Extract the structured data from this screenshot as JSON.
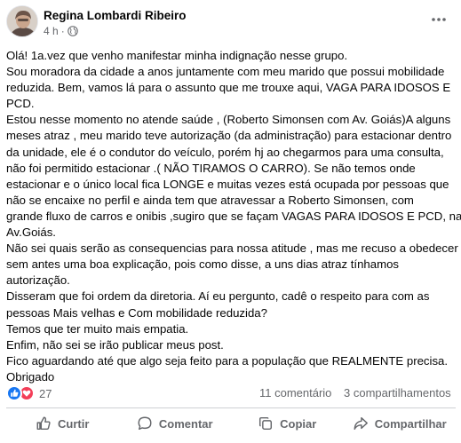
{
  "post": {
    "author": "Regina Lombardi Ribeiro",
    "time": "4 h",
    "meta_separator": "·",
    "privacy_icon": "globe-icon",
    "more_icon": "more-horizontal-icon",
    "text_lines": [
      "Olá! 1a.vez que venho manifestar minha indignação nesse grupo.",
      "Sou moradora da cidade a anos juntamente com meu marido que possui mobilidade",
      "reduzida. Bem, vamos lá para o assunto que me trouxe aqui, VAGA PARA IDOSOS E",
      "PCD.",
      "Estou nesse momento no atende saúde , (Roberto Simonsen com Av. Goiás)A alguns",
      "meses atraz , meu marido teve autorização (da administração) para estacionar dentro",
      "da unidade, ele é o condutor do veículo, porém hj ao chegarmos para uma consulta,",
      "não foi permitido estacionar .( NÃO TIRAMOS O CARRO). Se não temos onde",
      "estacionar e o único local fica LONGE e  muitas vezes está ocupada  por pessoas que",
      "não  se encaixe no perfil e ainda tem que atravessar a Roberto Simonsen,  com",
      "grande fluxo de carros e onibis ,sugiro que se façam VAGAS PARA IDOSOS E PCD, na",
      "Av.Goiás.",
      "Não sei quais serão as consequencias para nossa atitude , mas me recuso a obedecer",
      "sem antes uma boa explicação,  pois como disse, a uns dias atraz tínhamos",
      "autorização.",
      "Disseram que foi ordem da diretoria. Aí eu pergunto, cadê o respeito para com as",
      "pessoas Mais velhas e Com mobilidade reduzida?",
      "Temos que ter muito mais empatia.",
      "Enfim, não sei se irão publicar meus post.",
      "Fico aguardando até que algo seja feito para a população que REALMENTE precisa.",
      "Obrigado"
    ]
  },
  "stats": {
    "reactions_count": "27",
    "reaction_icons": [
      "like-reaction-icon",
      "love-reaction-icon"
    ],
    "comments": "11 comentário",
    "shares": "3 compartilhamentos"
  },
  "actions": {
    "like": "Curtir",
    "comment": "Comentar",
    "copy": "Copiar",
    "share": "Compartilhar"
  },
  "colors": {
    "text": "#050505",
    "secondary": "#65676b",
    "like_blue": "#1877f2",
    "love_red": "#f33e58",
    "divider": "#ced0d4"
  }
}
